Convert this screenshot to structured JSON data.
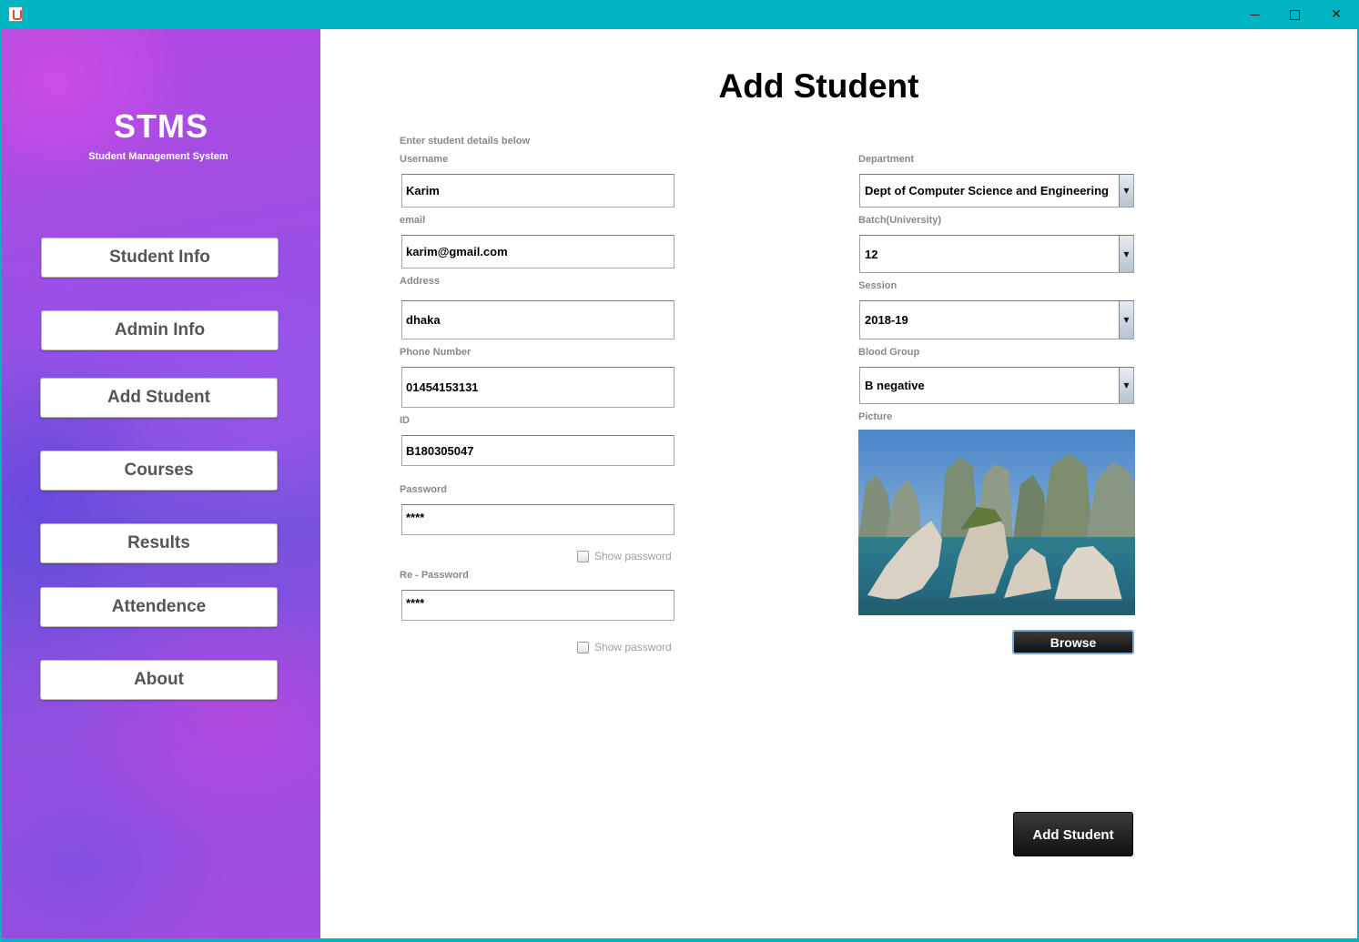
{
  "window": {
    "minimize_label": "─",
    "maximize_label": "☐",
    "close_label": "✕"
  },
  "sidebar": {
    "brand": "STMS",
    "subtitle": "Student Management System",
    "items": [
      {
        "label": "Student Info"
      },
      {
        "label": "Admin Info"
      },
      {
        "label": "Add Student"
      },
      {
        "label": "Courses"
      },
      {
        "label": "Results"
      },
      {
        "label": "Attendence"
      },
      {
        "label": "About"
      }
    ]
  },
  "main": {
    "title": "Add Student",
    "instructions": "Enter student details below",
    "left_fields": {
      "username": {
        "label": "Username",
        "value": "Karim"
      },
      "email": {
        "label": "email",
        "value": "karim@gmail.com"
      },
      "address": {
        "label": "Address",
        "value": "dhaka"
      },
      "phone": {
        "label": "Phone Number",
        "value": "01454153131"
      },
      "id": {
        "label": "ID",
        "value": "B180305047"
      },
      "password": {
        "label": "Password",
        "value": "****"
      },
      "repassword": {
        "label": "Re - Password",
        "value": "****"
      }
    },
    "show_password_label": "Show password",
    "right_fields": {
      "department": {
        "label": "Department",
        "value": "Dept of Computer Science and Engineering"
      },
      "batch": {
        "label": "Batch(University)",
        "value": "12"
      },
      "session": {
        "label": "Session",
        "value": "2018-19"
      },
      "blood_group": {
        "label": "Blood Group",
        "value": "B negative"
      }
    },
    "picture_label": "Picture",
    "browse_label": "Browse",
    "submit_label": "Add Student"
  },
  "colors": {
    "titlebar": "#00b4c1",
    "sidebar_purple": "#9651e6",
    "dark_button": "#1a1a1a"
  }
}
